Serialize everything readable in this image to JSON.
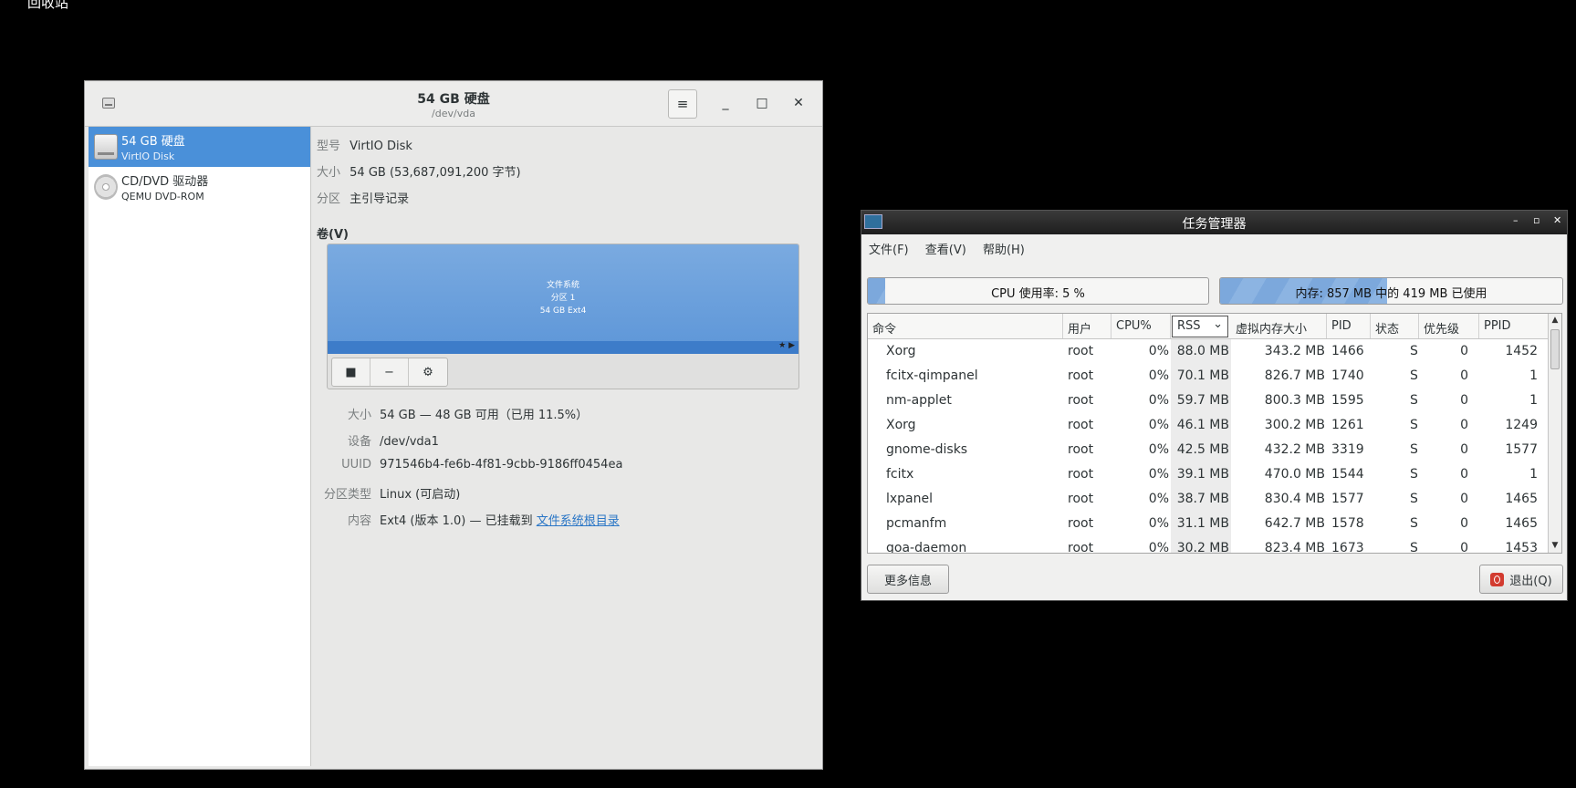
{
  "desktop": {
    "label": "回收站"
  },
  "disks": {
    "title": "54 GB 硬盘",
    "subtitle": "/dev/vda",
    "menu_glyph": "≡",
    "minimize_glyph": "_",
    "maximize_glyph": "□",
    "close_glyph": "✕",
    "devices": [
      {
        "name": "54 GB 硬盘",
        "sub": "VirtIO Disk"
      },
      {
        "name": "CD/DVD 驱动器",
        "sub": "QEMU DVD-ROM"
      }
    ],
    "info": {
      "model_label": "型号",
      "model_value": "VirtIO Disk",
      "size_label": "大小",
      "size_value": "54 GB (53,687,091,200 字节)",
      "partition_label": "分区",
      "partition_value": "主引导记录"
    },
    "volumes_label": "卷(V)",
    "volume_block": {
      "line1": "文件系统",
      "line2": "分区 1",
      "line3": "54 GB Ext4",
      "marks": "★ ▶"
    },
    "volume_tools": {
      "stop": "■",
      "remove": "−",
      "settings": "⚙"
    },
    "details": {
      "size_label": "大小",
      "size_value": "54 GB — 48 GB 可用（已用 11.5%）",
      "device_label": "设备",
      "device_value": "/dev/vda1",
      "uuid_label": "UUID",
      "uuid_value": "971546b4-fe6b-4f81-9cbb-9186ff0454ea",
      "ptype_label": "分区类型",
      "ptype_value": "Linux (可启动)",
      "content_label": "内容",
      "content_value": "Ext4 (版本 1.0) — 已挂载到 ",
      "content_link": "文件系统根目录"
    }
  },
  "taskmanager": {
    "title": "任务管理器",
    "controls": {
      "min": "–",
      "max": "▫",
      "close": "✕"
    },
    "menu": {
      "file": "文件(F)",
      "view": "查看(V)",
      "help": "帮助(H)"
    },
    "cpu_text": "CPU 使用率: 5 %",
    "cpu_fraction": 0.05,
    "mem_text": "内存: 857 MB 中的 419 MB 已使用",
    "mem_fraction": 0.489,
    "columns": {
      "command": "命令",
      "user": "用户",
      "cpu": "CPU%",
      "rss": "RSS",
      "vmem": "虚拟内存大小",
      "pid": "PID",
      "state": "状态",
      "prio": "优先级",
      "ppid": "PPID"
    },
    "sort_indicator": "⌄",
    "processes": [
      {
        "cmd": "Xorg",
        "user": "root",
        "cpu": "0%",
        "rss": "88.0 MB",
        "vmem": "343.2 MB",
        "pid": "1466",
        "state": "S",
        "prio": "0",
        "ppid": "1452"
      },
      {
        "cmd": "fcitx-qimpanel",
        "user": "root",
        "cpu": "0%",
        "rss": "70.1 MB",
        "vmem": "826.7 MB",
        "pid": "1740",
        "state": "S",
        "prio": "0",
        "ppid": "1"
      },
      {
        "cmd": "nm-applet",
        "user": "root",
        "cpu": "0%",
        "rss": "59.7 MB",
        "vmem": "800.3 MB",
        "pid": "1595",
        "state": "S",
        "prio": "0",
        "ppid": "1"
      },
      {
        "cmd": "Xorg",
        "user": "root",
        "cpu": "0%",
        "rss": "46.1 MB",
        "vmem": "300.2 MB",
        "pid": "1261",
        "state": "S",
        "prio": "0",
        "ppid": "1249"
      },
      {
        "cmd": "gnome-disks",
        "user": "root",
        "cpu": "0%",
        "rss": "42.5 MB",
        "vmem": "432.2 MB",
        "pid": "3319",
        "state": "S",
        "prio": "0",
        "ppid": "1577"
      },
      {
        "cmd": "fcitx",
        "user": "root",
        "cpu": "0%",
        "rss": "39.1 MB",
        "vmem": "470.0 MB",
        "pid": "1544",
        "state": "S",
        "prio": "0",
        "ppid": "1"
      },
      {
        "cmd": "lxpanel",
        "user": "root",
        "cpu": "0%",
        "rss": "38.7 MB",
        "vmem": "830.4 MB",
        "pid": "1577",
        "state": "S",
        "prio": "0",
        "ppid": "1465"
      },
      {
        "cmd": "pcmanfm",
        "user": "root",
        "cpu": "0%",
        "rss": "31.1 MB",
        "vmem": "642.7 MB",
        "pid": "1578",
        "state": "S",
        "prio": "0",
        "ppid": "1465"
      },
      {
        "cmd": "goa-daemon",
        "user": "root",
        "cpu": "0%",
        "rss": "30.2 MB",
        "vmem": "823.4 MB",
        "pid": "1673",
        "state": "S",
        "prio": "0",
        "ppid": "1453"
      }
    ],
    "more_info_label": "更多信息",
    "quit_label": "退出(Q)"
  }
}
